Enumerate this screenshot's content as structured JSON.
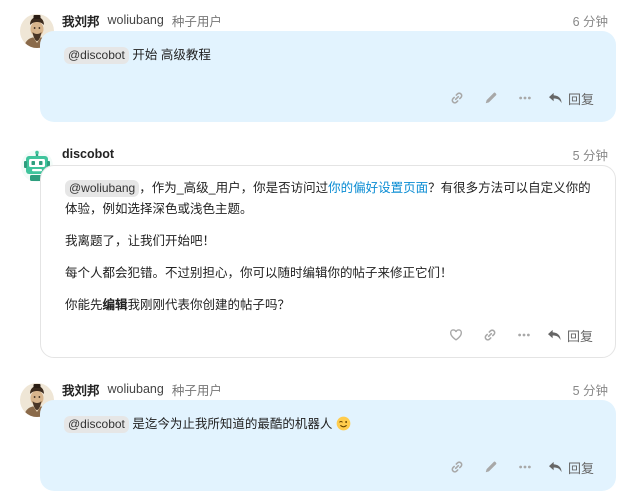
{
  "colors": {
    "user_bubble": "#e2f3fe",
    "bot_bubble": "#ffffff",
    "link": "#0a8cd3",
    "icon": "#a8a8a8"
  },
  "posts": [
    {
      "name": "我刘邦",
      "username": "woliubang",
      "title": "种子用户",
      "time": "6 分钟",
      "mention": "@discobot",
      "text": "开始 高级教程",
      "reply_label": "回复",
      "avatar_icon": "user-avatar-icon"
    },
    {
      "name": "discobot",
      "time": "5 分钟",
      "mention": "@woliubang",
      "p1_before": "，作为_高级_用户，你是否访问过",
      "p1_link": "你的偏好设置页面",
      "p1_after": "？有很多方法可以自定义你的体验，例如选择深色或浅色主题。",
      "p2": "我离题了，让我们开始吧！",
      "p3": "每个人都会犯错。不过别担心，你可以随时编辑你的帖子来修正它们！",
      "p4_before": "你能先",
      "p4_bold": "编辑",
      "p4_after": "我刚刚代表你创建的帖子吗？",
      "reply_label": "回复",
      "avatar_icon": "robot-avatar-icon"
    },
    {
      "name": "我刘邦",
      "username": "woliubang",
      "title": "种子用户",
      "time": "5 分钟",
      "mention": "@discobot",
      "text": "是迄今为止我所知道的最酷的机器人",
      "emoji": "wink-emoji-icon",
      "reply_label": "回复",
      "avatar_icon": "user-avatar-icon"
    }
  ]
}
